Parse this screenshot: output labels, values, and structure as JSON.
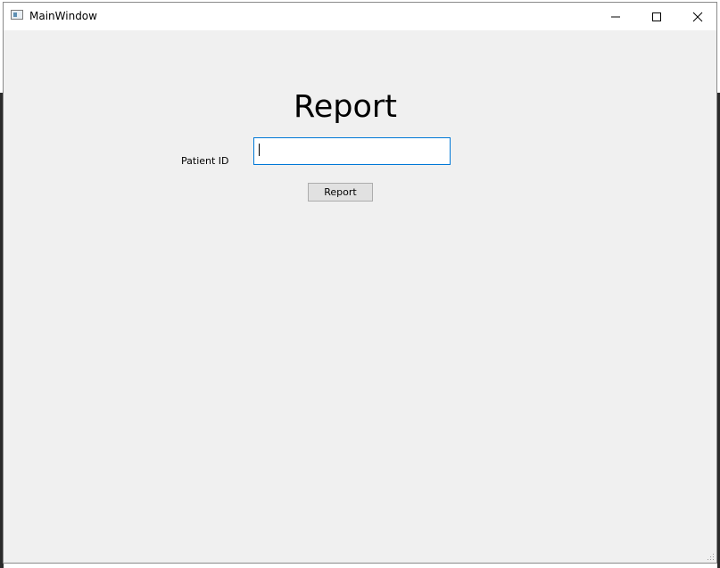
{
  "window": {
    "title": "MainWindow",
    "icon": "app-window-icon",
    "controls": [
      "minimize-icon",
      "maximize-icon",
      "close-icon"
    ]
  },
  "main": {
    "heading": "Report",
    "patient_id_label": "Patient ID",
    "patient_id_value": "",
    "report_button_label": "Report"
  },
  "colors": {
    "window_background": "#f0f0f0",
    "titlebar_background": "#ffffff",
    "input_focus_border": "#0078d7",
    "button_background": "#e1e1e1"
  }
}
